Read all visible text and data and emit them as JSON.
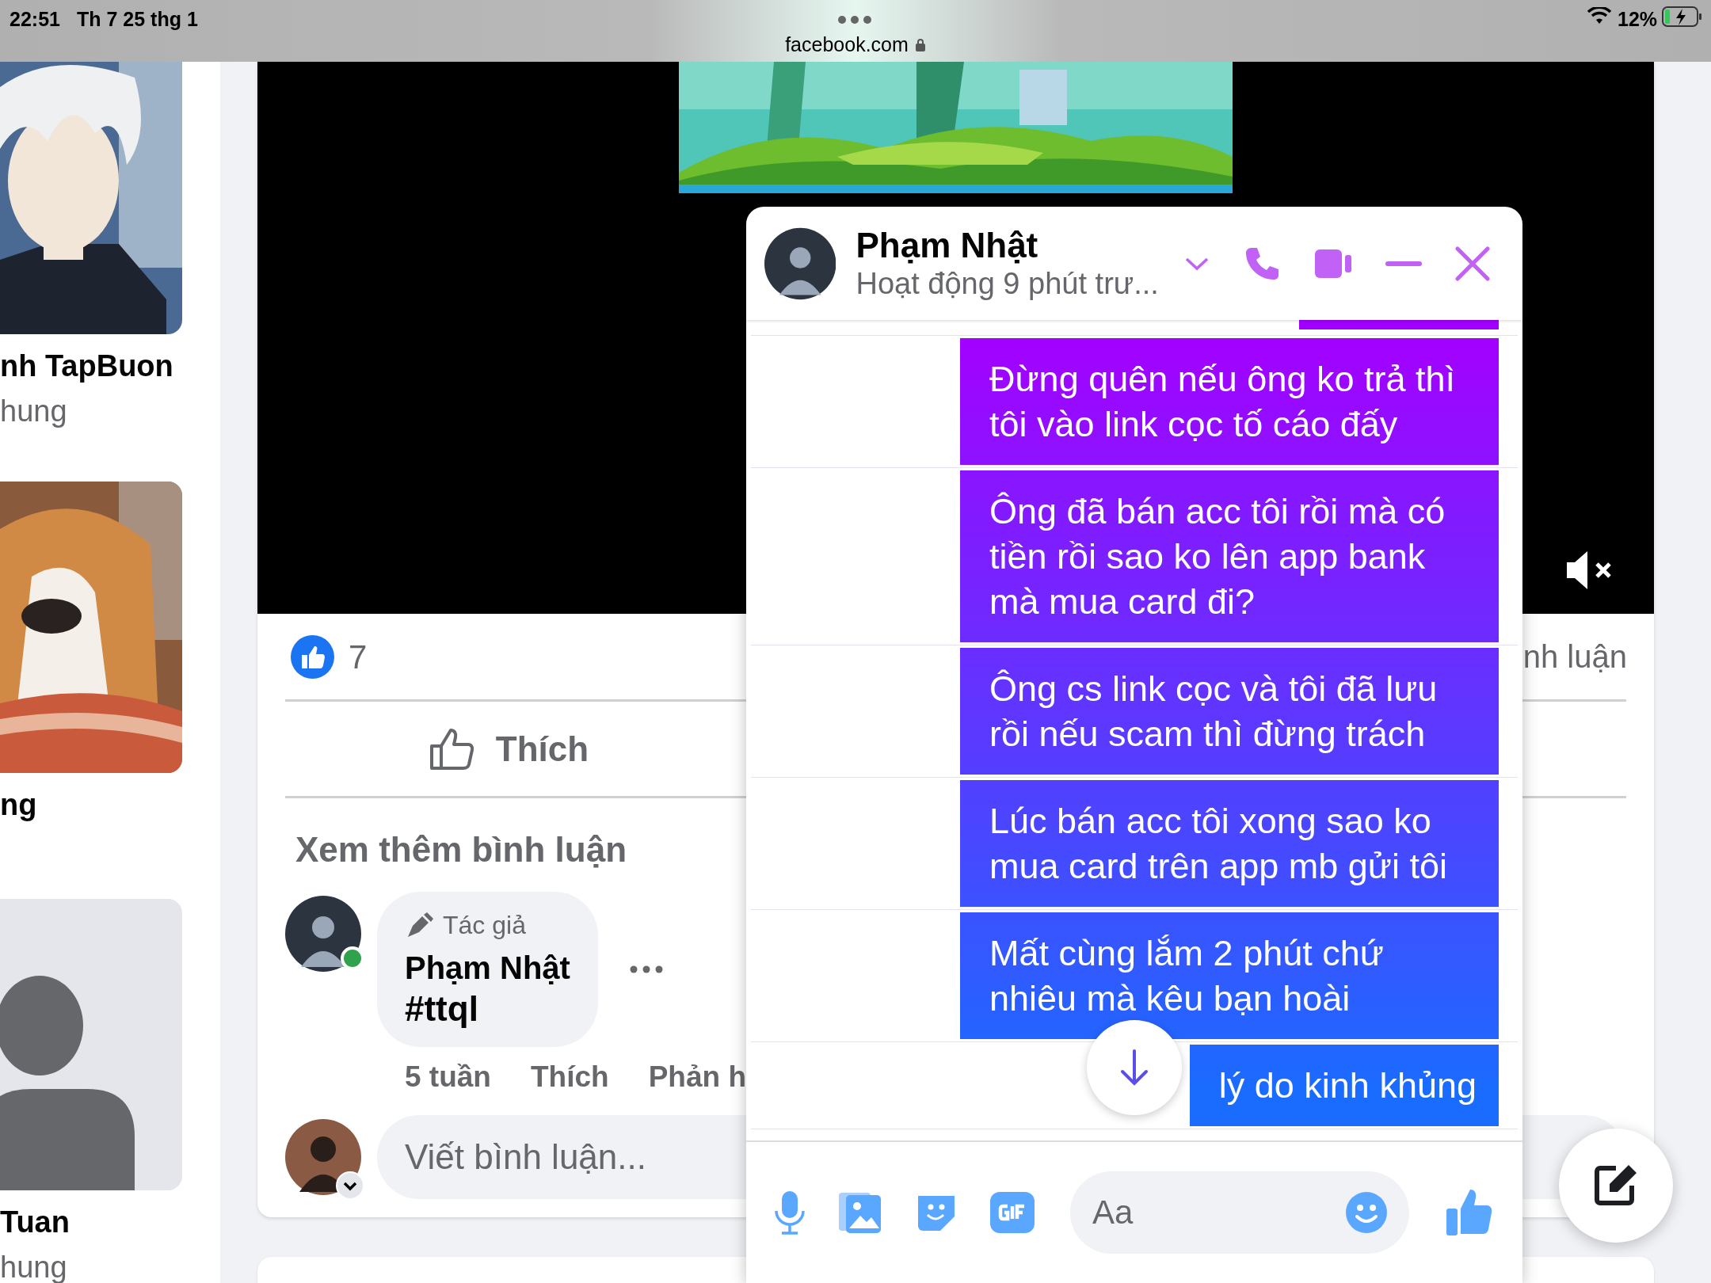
{
  "status_bar": {
    "time": "22:51",
    "date": "Th 7 25 thg 1",
    "url": "facebook.com",
    "battery": "12%"
  },
  "left_column": {
    "people": [
      {
        "kind": "picture",
        "name": "nh TapBuon",
        "subtitle": "hung"
      },
      {
        "kind": "picture",
        "name": "ng"
      },
      {
        "kind": "placeholder",
        "name": "Tuan",
        "subtitle": "hung"
      }
    ]
  },
  "post": {
    "like_count": "7",
    "comments_label": "nh luận",
    "like_button": "Thích",
    "more_comments": "Xem thêm bình luận",
    "comment": {
      "badge": "Tác giả",
      "author": "Phạm Nhật",
      "text": "#ttql",
      "online": true,
      "time": "5 tuần",
      "actions": [
        "Thích",
        "Phản h"
      ]
    },
    "write_comment": {
      "placeholder": "Viết bình luận..."
    }
  },
  "chat": {
    "name": "Phạm Nhật",
    "status": "Hoạt động 9 phút trư...",
    "messages": [
      {
        "text": "Đừng quên nếu ông ko trả thì tôi vào link cọc tố cáo đấy"
      },
      {
        "text": "Ông đã bán acc tôi rồi mà có tiền rồi sao ko lên app bank mà mua card đi?"
      },
      {
        "text": "Ông cs link cọc và tôi đã lưu rồi nếu scam thì đừng trách"
      },
      {
        "text": "Lúc bán acc tôi xong sao ko mua card trên app mb gửi tôi"
      },
      {
        "text": "Mất cùng lắm 2 phút chứ nhiêu mà kêu bạn hoài"
      },
      {
        "text": "lý do kinh khủng"
      }
    ],
    "composer": {
      "placeholder": "Aa"
    }
  }
}
